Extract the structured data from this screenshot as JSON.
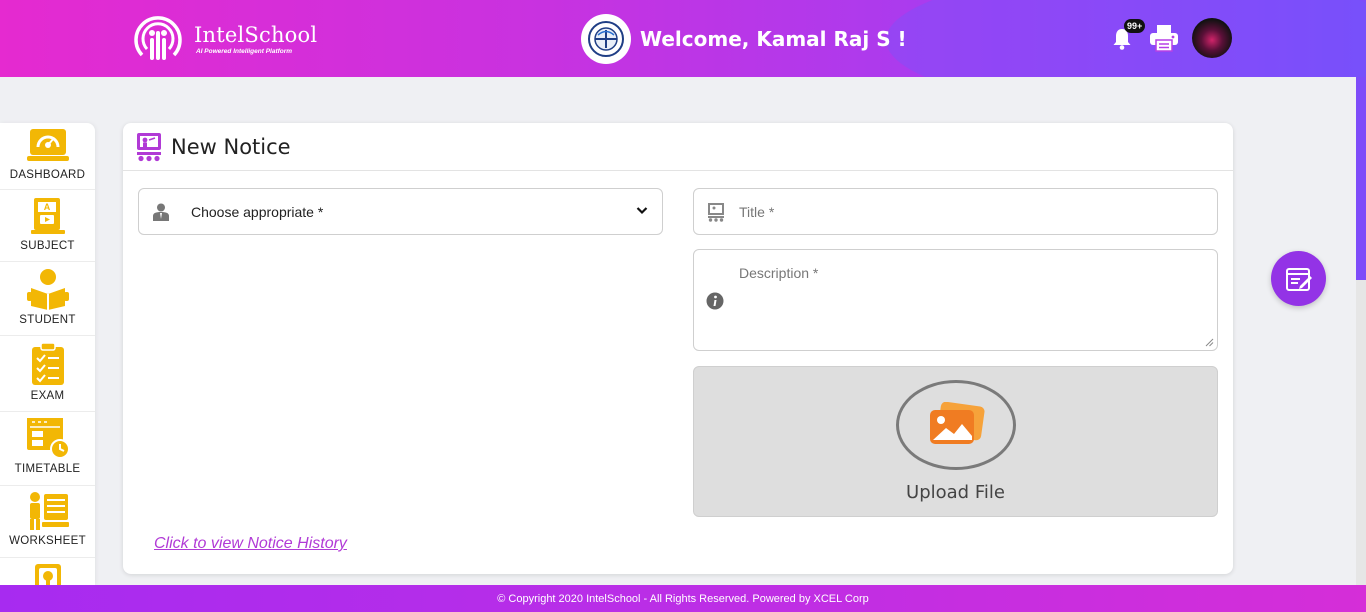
{
  "header": {
    "logo_name": "IntelSchool",
    "logo_tagline": "AI Powered Intelligent Platform",
    "welcome": "Welcome, Kamal Raj S !",
    "notification_count": "99+",
    "gradient_colors": [
      "#e52ad0",
      "#7e4cf9"
    ]
  },
  "sidebar": {
    "accent": "#f2b705",
    "items": [
      {
        "label": "DASHBOARD",
        "icon": "dashboard-icon"
      },
      {
        "label": "SUBJECT",
        "icon": "subject-book-icon"
      },
      {
        "label": "STUDENT",
        "icon": "student-reading-icon"
      },
      {
        "label": "EXAM",
        "icon": "exam-checklist-icon"
      },
      {
        "label": "TIMETABLE",
        "icon": "timetable-icon"
      },
      {
        "label": "WORKSHEET",
        "icon": "worksheet-icon"
      },
      {
        "label": "",
        "icon": "idea-icon"
      }
    ]
  },
  "notice": {
    "title": "New Notice",
    "select_value": "Choose appropriate *",
    "title_placeholder": "Title *",
    "description_placeholder": "Description *",
    "upload_label": "Upload File",
    "history_link": "Click to view Notice History"
  },
  "footer": {
    "text": "© Copyright 2020 IntelSchool - All Rights Reserved. Powered by XCEL Corp"
  }
}
